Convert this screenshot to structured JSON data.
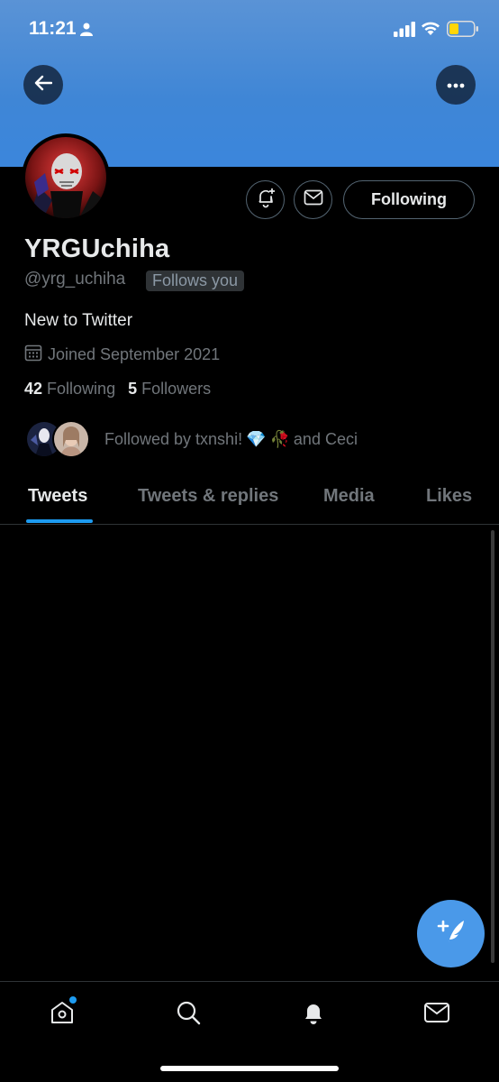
{
  "status_bar": {
    "time": "11:21",
    "icons": [
      "person-icon",
      "signal-icon",
      "wifi-icon",
      "battery-icon"
    ]
  },
  "header": {
    "back_icon": "arrow-left-icon",
    "more_icon": "ellipsis-icon",
    "banner_color": "#3f86d6"
  },
  "profile": {
    "display_name": "YRGUchiha",
    "handle": "@yrg_uchiha",
    "follows_you_badge": "Follows you",
    "bio": "New to Twitter",
    "joined": "Joined September 2021",
    "following_count": "42",
    "following_label": "Following",
    "followers_count": "5",
    "followers_label": "Followers",
    "followed_by_prefix": "Followed by txnshi!",
    "followed_by_emoji_1": "💎",
    "followed_by_emoji_2": "🥀",
    "followed_by_suffix": "and Ceci"
  },
  "actions": {
    "notify_icon": "bell-plus-icon",
    "message_icon": "envelope-icon",
    "following_button": "Following"
  },
  "tabs": [
    {
      "label": "Tweets",
      "active": true
    },
    {
      "label": "Tweets & replies",
      "active": false
    },
    {
      "label": "Media",
      "active": false
    },
    {
      "label": "Likes",
      "active": false
    }
  ],
  "fab": {
    "icon": "compose-tweet-icon",
    "color": "#4a99e9"
  },
  "bottom_nav": [
    {
      "icon": "home-icon",
      "has_badge": true
    },
    {
      "icon": "search-icon"
    },
    {
      "icon": "bell-icon"
    },
    {
      "icon": "mail-icon"
    }
  ],
  "colors": {
    "accent": "#1d9bf0",
    "background": "#000000",
    "text_primary": "#e7e9ea",
    "text_secondary": "#71767b"
  }
}
